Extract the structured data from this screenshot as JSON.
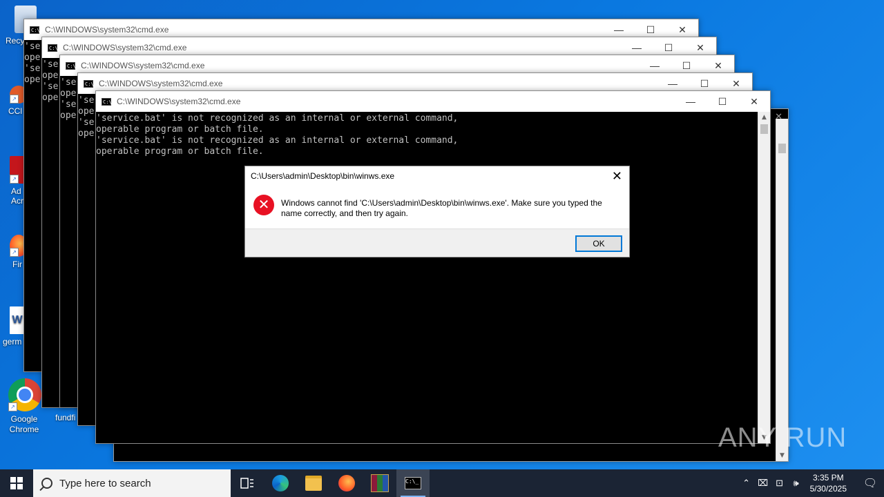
{
  "desktop": {
    "icons": [
      {
        "label": "Recy",
        "icon": "recycle-bin-icon"
      },
      {
        "label": "CCl",
        "icon": "ccleaner-icon"
      },
      {
        "label": "Ad Acr",
        "icon": "adobe-acrobat-icon"
      },
      {
        "label": "Fir",
        "icon": "firefox-icon"
      },
      {
        "label": "germ",
        "icon": "word-document-icon"
      },
      {
        "label": "Google Chrome",
        "icon": "chrome-icon"
      },
      {
        "label": "fundfi",
        "icon": "file-icon"
      }
    ]
  },
  "cmd_windows": [
    {
      "title": "C:\\WINDOWS\\system32\\cmd.exe",
      "lines": [
        "'se",
        "ope",
        "'se",
        "ope"
      ]
    },
    {
      "title": "C:\\WINDOWS\\system32\\cmd.exe",
      "lines": [
        "'se",
        "ope",
        "'se",
        "ope"
      ]
    },
    {
      "title": "C:\\WINDOWS\\system32\\cmd.exe",
      "lines": [
        "'se",
        "ope",
        "'se",
        "ope"
      ]
    },
    {
      "title": "C:\\WINDOWS\\system32\\cmd.exe",
      "lines": [
        "'se",
        "ope",
        "'se",
        "ope"
      ]
    },
    {
      "title": "C:\\WINDOWS\\system32\\cmd.exe",
      "lines": [
        "'service.bat' is not recognized as an internal or external command,",
        "operable program or batch file.",
        "'service.bat' is not recognized as an internal or external command,",
        "operable program or batch file."
      ]
    }
  ],
  "window_controls": {
    "minimize": "—",
    "maximize": "☐",
    "close": "✕"
  },
  "dialog": {
    "title": "C:\\Users\\admin\\Desktop\\bin\\winws.exe",
    "message": "Windows cannot find 'C:\\Users\\admin\\Desktop\\bin\\winws.exe'. Make sure you typed the name correctly, and then try again.",
    "ok_label": "OK",
    "icon": "error-icon"
  },
  "watermark": "ANY RUN",
  "taskbar": {
    "search_placeholder": "Type here to search",
    "apps": [
      "task-view-icon",
      "edge-icon",
      "file-explorer-icon",
      "firefox-icon",
      "winrar-icon",
      "cmd-icon"
    ],
    "time": "3:35 PM",
    "date": "5/30/2025"
  },
  "colors": {
    "desktop": "#0a78e0",
    "taskbar": "#1b2434",
    "error": "#e81123",
    "accent": "#0078d7"
  }
}
